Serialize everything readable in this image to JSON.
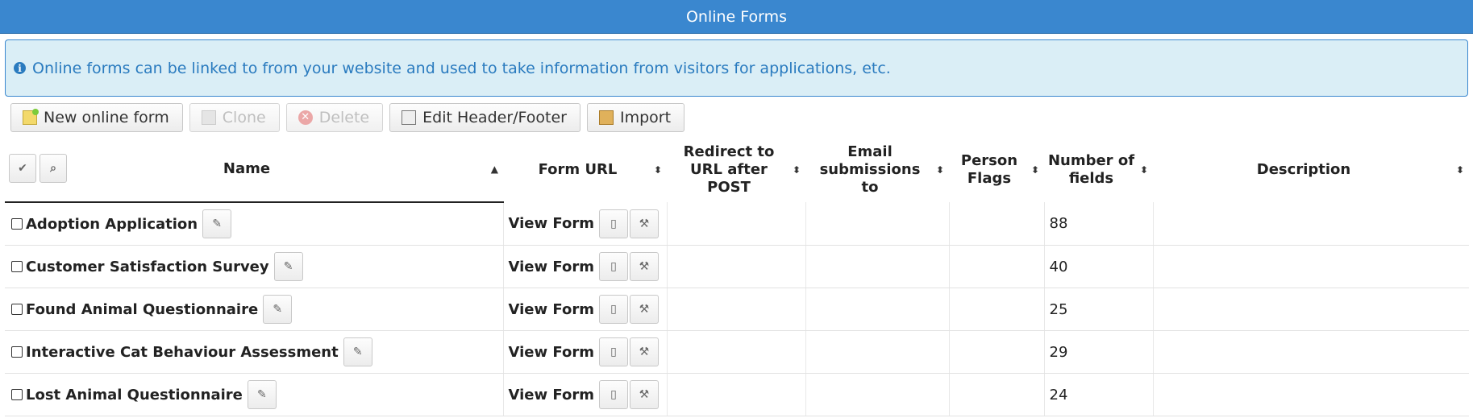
{
  "header": {
    "title": "Online Forms"
  },
  "info": {
    "text": "Online forms can be linked to from your website and used to take information from visitors for applications, etc."
  },
  "toolbar": {
    "new_label": "New online form",
    "clone_label": "Clone",
    "delete_label": "Delete",
    "edit_label": "Edit Header/Footer",
    "import_label": "Import"
  },
  "table": {
    "columns": {
      "name": "Name",
      "url": "Form URL",
      "redirect": "Redirect to URL after POST",
      "email": "Email submissions to",
      "flags": "Person Flags",
      "fields": "Number of fields",
      "description": "Description"
    },
    "view_label": "View Form",
    "rows": [
      {
        "name": "Adoption Application",
        "fields": "88"
      },
      {
        "name": "Customer Satisfaction Survey",
        "fields": "40"
      },
      {
        "name": "Found Animal Questionnaire",
        "fields": "25"
      },
      {
        "name": "Interactive Cat Behaviour Assessment",
        "fields": "29"
      },
      {
        "name": "Lost Animal Questionnaire",
        "fields": "24"
      }
    ]
  },
  "icons": {
    "info": "info-icon",
    "check": "check-icon",
    "search": "search-icon",
    "edit": "pencil-icon",
    "clipboard": "clipboard-icon",
    "wrench": "wrench-icon",
    "sort": "sort-icon",
    "sort_asc": "sort-ascending-icon"
  },
  "colors": {
    "accent": "#3a87cf",
    "info_bg": "#daeef6",
    "info_text": "#2a7bbf"
  }
}
